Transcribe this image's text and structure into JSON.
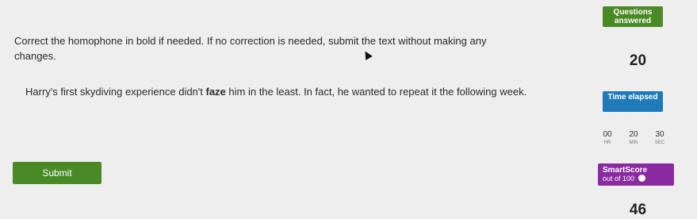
{
  "question": {
    "instructions": "Correct the homophone in bold if needed. If no correction is needed, submit the text without making any changes.",
    "sentence_before": "Harry's first skydiving experience didn't ",
    "bold_word": "faze",
    "sentence_after": " him in the least. In fact, he wanted to repeat it the following week."
  },
  "submit_label": "Submit",
  "sidebar": {
    "questions_answered_label": "Questions answered",
    "questions_answered_value": "20",
    "time_elapsed_label": "Time elapsed",
    "timer": [
      {
        "value": "00",
        "unit": "HR"
      },
      {
        "value": "20",
        "unit": "MIN"
      },
      {
        "value": "30",
        "unit": "SEC"
      }
    ],
    "smartscore_label": "SmartScore",
    "smartscore_sub": "out of 100",
    "smartscore_value": "46"
  },
  "colors": {
    "green": "#4a8a25",
    "blue": "#1e7ab8",
    "purple": "#8a2aa0"
  }
}
